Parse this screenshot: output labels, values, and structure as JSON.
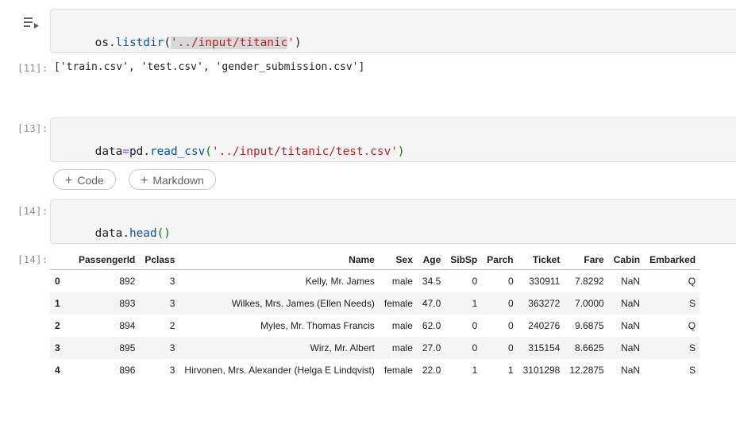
{
  "cells": [
    {
      "exec_count": "",
      "code": {
        "obj": "os",
        "dot": ".",
        "fn": "listdir",
        "open": "(",
        "q1": "'",
        "arg": "../input/titanic",
        "q2": "'",
        "close": ")"
      },
      "output_label": "[11]:",
      "output": "['train.csv', 'test.csv', 'gender_submission.csv']"
    },
    {
      "exec_count": "[13]:",
      "code": {
        "var": "data",
        "eq": "=",
        "obj": "pd",
        "dot": ".",
        "fn": "read_csv",
        "open": "(",
        "str": "'../input/titanic/test.csv'",
        "close": ")"
      }
    },
    {
      "exec_count": "[14]:",
      "code": {
        "var": "data",
        "dot": ".",
        "fn": "head",
        "parens": "()"
      },
      "output_label": "[14]:"
    }
  ],
  "add_buttons": {
    "code": "Code",
    "markdown": "Markdown",
    "plus": "+"
  },
  "table": {
    "columns": [
      "",
      "PassengerId",
      "Pclass",
      "Name",
      "Sex",
      "Age",
      "SibSp",
      "Parch",
      "Ticket",
      "Fare",
      "Cabin",
      "Embarked"
    ],
    "rows": [
      [
        "0",
        "892",
        "3",
        "Kelly, Mr. James",
        "male",
        "34.5",
        "0",
        "0",
        "330911",
        "7.8292",
        "NaN",
        "Q"
      ],
      [
        "1",
        "893",
        "3",
        "Wilkes, Mrs. James (Ellen Needs)",
        "female",
        "47.0",
        "1",
        "0",
        "363272",
        "7.0000",
        "NaN",
        "S"
      ],
      [
        "2",
        "894",
        "2",
        "Myles, Mr. Thomas Francis",
        "male",
        "62.0",
        "0",
        "0",
        "240276",
        "9.6875",
        "NaN",
        "Q"
      ],
      [
        "3",
        "895",
        "3",
        "Wirz, Mr. Albert",
        "male",
        "27.0",
        "0",
        "0",
        "315154",
        "8.6625",
        "NaN",
        "S"
      ],
      [
        "4",
        "896",
        "3",
        "Hirvonen, Mrs. Alexander (Helga E Lindqvist)",
        "female",
        "22.0",
        "1",
        "1",
        "3101298",
        "12.2875",
        "NaN",
        "S"
      ]
    ]
  },
  "icons": {
    "run": "run-cell-icon"
  }
}
